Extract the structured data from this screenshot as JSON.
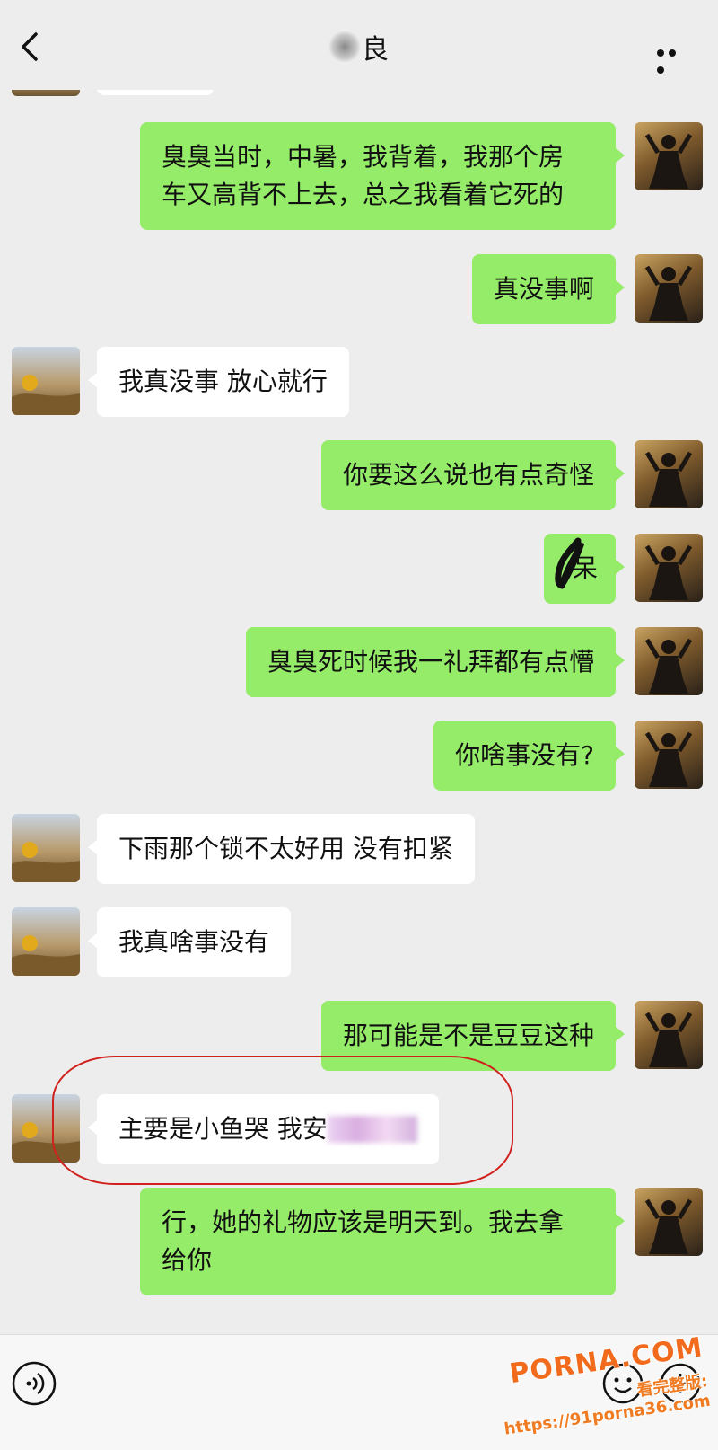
{
  "header": {
    "title_visible": "良",
    "back_icon": "chevron-left-icon",
    "more_icon": "ellipsis-icon"
  },
  "messages": [
    {
      "side": "me",
      "text": "臭臭当时，中暑，我背着，我那个房\n车又高背不上去，总之我看着它死的"
    },
    {
      "side": "me",
      "text": "真没事啊"
    },
    {
      "side": "them",
      "text": "我真没事 放心就行"
    },
    {
      "side": "me",
      "text": "你要这么说也有点奇怪"
    },
    {
      "side": "me",
      "text": "呆",
      "scribbled": true
    },
    {
      "side": "me",
      "text": "臭臭死时候我一礼拜都有点懵"
    },
    {
      "side": "me",
      "text": "你啥事没有?"
    },
    {
      "side": "them",
      "text": "下雨那个锁不太好用 没有扣紧"
    },
    {
      "side": "them",
      "text": "我真啥事没有"
    },
    {
      "side": "me",
      "text": "那可能是不是豆豆这种"
    },
    {
      "side": "them",
      "text": "主要是小鱼哭 我安",
      "blurred_tail": true,
      "highlighted": true
    },
    {
      "side": "me",
      "text": "行，她的礼物应该是明天到。我去拿\n给你"
    }
  ],
  "input_bar": {
    "voice_icon": "voice-icon",
    "emoji_icon": "emoji-icon",
    "plus_icon": "plus-icon"
  },
  "watermark": {
    "logo": "PORNA.COM",
    "line": "看完整版: https://91porna36.com"
  },
  "colors": {
    "background": "#ededed",
    "my_bubble": "#95ec69",
    "their_bubble": "#ffffff",
    "highlight_ring": "#d0211d",
    "watermark": "#f26b1d"
  }
}
